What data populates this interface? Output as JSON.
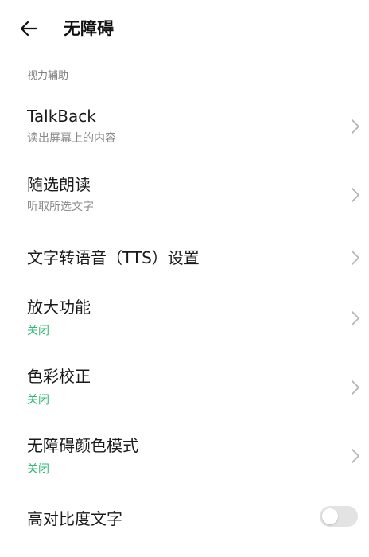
{
  "header": {
    "back_icon": "back-arrow-icon",
    "title": "无障碍"
  },
  "section": {
    "label": "视力辅助"
  },
  "items": [
    {
      "title": "TalkBack",
      "subtitle": "读出屏幕上的内容",
      "chevron": "chevron-right-icon"
    },
    {
      "title": "随选朗读",
      "subtitle": "听取所选文字",
      "chevron": "chevron-right-icon"
    },
    {
      "title": "文字转语音（TTS）设置",
      "subtitle": "",
      "chevron": "chevron-right-icon"
    },
    {
      "title": "放大功能",
      "subtitle": "关闭",
      "chevron": "chevron-right-icon"
    },
    {
      "title": "色彩校正",
      "subtitle": "关闭",
      "chevron": "chevron-right-icon"
    },
    {
      "title": "无障碍颜色模式",
      "subtitle": "关闭",
      "chevron": "chevron-right-icon"
    },
    {
      "title": "高对比度文字",
      "toggle_state": "off"
    }
  ],
  "colors": {
    "status_off": "#2eb872",
    "subtitle_gray": "#8a8a8a",
    "section_gray": "#808080",
    "toggle_track": "#e3e3e3"
  }
}
